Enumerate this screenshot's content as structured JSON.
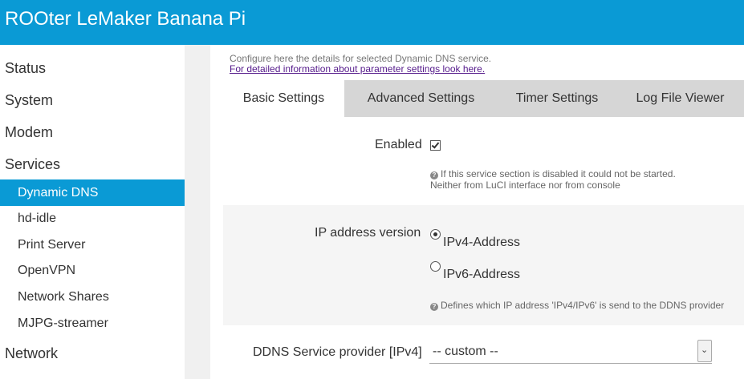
{
  "header": {
    "title": "ROOter LeMaker Banana Pi"
  },
  "sidebar": {
    "items": [
      {
        "label": "Status"
      },
      {
        "label": "System"
      },
      {
        "label": "Modem"
      },
      {
        "label": "Services"
      },
      {
        "label": "Dynamic DNS"
      },
      {
        "label": "hd-idle"
      },
      {
        "label": "Print Server"
      },
      {
        "label": "OpenVPN"
      },
      {
        "label": "Network Shares"
      },
      {
        "label": "MJPG-streamer"
      },
      {
        "label": "Network"
      }
    ]
  },
  "main": {
    "description": "Configure here the details for selected Dynamic DNS service.",
    "info_link": "For detailed information about parameter settings look here.",
    "tabs": [
      {
        "label": "Basic Settings"
      },
      {
        "label": "Advanced Settings"
      },
      {
        "label": "Timer Settings"
      },
      {
        "label": "Log File Viewer"
      }
    ],
    "enabled": {
      "label": "Enabled",
      "checked": true,
      "help_line1": "If this service section is disabled it could not be started.",
      "help_line2": "Neither from LuCI interface nor from console"
    },
    "ip_version": {
      "label": "IP address version",
      "options": [
        {
          "label": "IPv4-Address",
          "selected": true
        },
        {
          "label": "IPv6-Address",
          "selected": false
        }
      ],
      "help": "Defines which IP address 'IPv4/IPv6' is send to the DDNS provider"
    },
    "provider": {
      "label": "DDNS Service provider [IPv4]",
      "value": "-- custom --"
    }
  },
  "colors": {
    "accent": "#0a9ad5",
    "tab_bar": "#d6d6d6",
    "link": "#551a8b"
  },
  "icons": {
    "help": "help-circle-icon",
    "select_arrow": "chevron-down-icon"
  }
}
